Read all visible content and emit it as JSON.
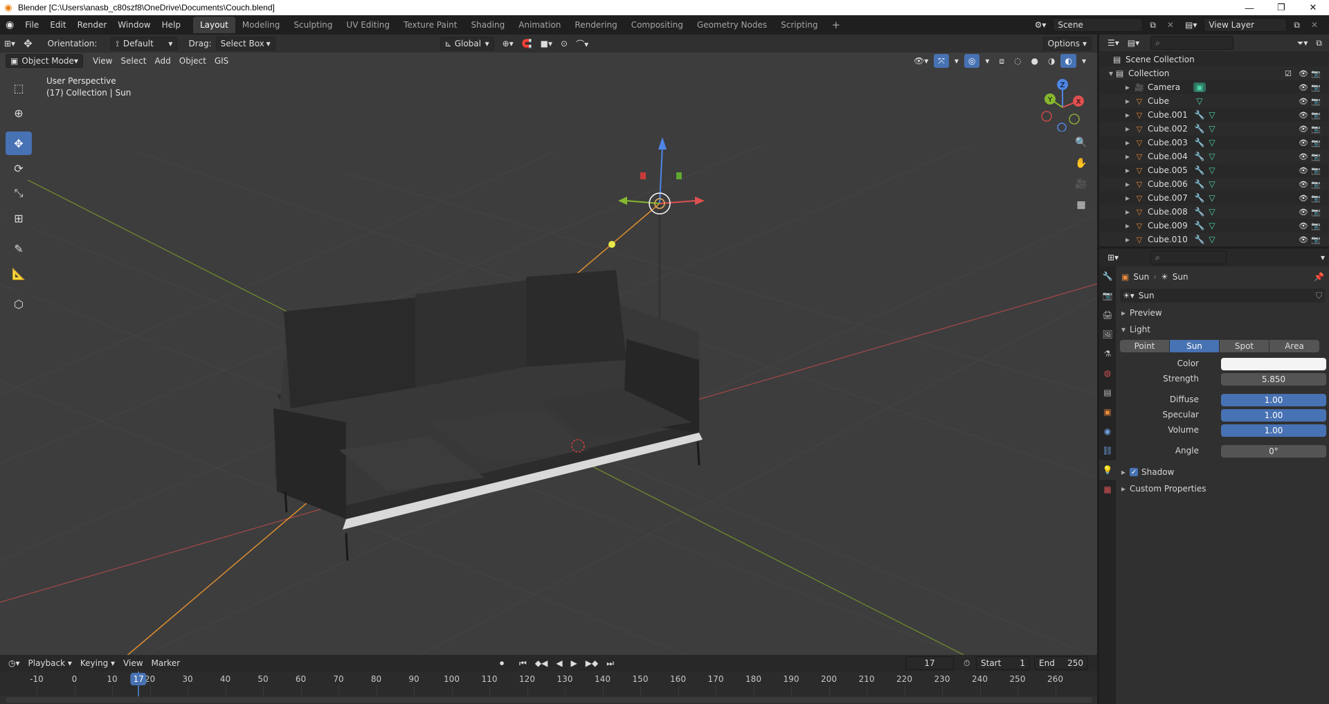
{
  "window": {
    "title": "Blender [C:\\Users\\anasb_c80szf8\\OneDrive\\Documents\\Couch.blend]",
    "controls": [
      "—",
      "❐",
      "✕"
    ]
  },
  "menu": [
    "File",
    "Edit",
    "Render",
    "Window",
    "Help"
  ],
  "workspaces": [
    "Layout",
    "Modeling",
    "Sculpting",
    "UV Editing",
    "Texture Paint",
    "Shading",
    "Animation",
    "Rendering",
    "Compositing",
    "Geometry Nodes",
    "Scripting"
  ],
  "active_workspace": "Layout",
  "scene": {
    "name": "Scene",
    "view_layer": "View Layer"
  },
  "tool_header": {
    "orientation_label": "Orientation:",
    "orientation_value": "Default",
    "drag_label": "Drag:",
    "drag_value": "Select Box",
    "transform_orientation": "Global",
    "options": "Options"
  },
  "viewport_header": {
    "mode": "Object Mode",
    "menus": [
      "View",
      "Select",
      "Add",
      "Object",
      "GIS"
    ]
  },
  "viewport": {
    "perspective": "User Perspective",
    "collection_info": "(17) Collection | Sun",
    "gizmo_axes": {
      "z": "Z",
      "y": "Y",
      "x": "X"
    }
  },
  "timeline": {
    "menus": [
      "Playback",
      "Keying",
      "View",
      "Marker"
    ],
    "current_frame": "17",
    "start_label": "Start",
    "start": "1",
    "end_label": "End",
    "end": "250",
    "ruler": [
      "-10",
      "0",
      "10",
      "20",
      "30",
      "40",
      "50",
      "60",
      "70",
      "80",
      "90",
      "100",
      "110",
      "120",
      "130",
      "140",
      "150",
      "160",
      "170",
      "180",
      "190",
      "200",
      "210",
      "220",
      "230",
      "240",
      "250",
      "260"
    ],
    "playhead": "17"
  },
  "outliner": {
    "scene_collection": "Scene Collection",
    "collection": "Collection",
    "items": [
      {
        "name": "Camera",
        "type": "camera"
      },
      {
        "name": "Cube",
        "type": "mesh"
      },
      {
        "name": "Cube.001",
        "type": "mesh_mod"
      },
      {
        "name": "Cube.002",
        "type": "mesh_mod"
      },
      {
        "name": "Cube.003",
        "type": "mesh_mod"
      },
      {
        "name": "Cube.004",
        "type": "mesh_mod"
      },
      {
        "name": "Cube.005",
        "type": "mesh_mod"
      },
      {
        "name": "Cube.006",
        "type": "mesh_mod"
      },
      {
        "name": "Cube.007",
        "type": "mesh_mod"
      },
      {
        "name": "Cube.008",
        "type": "mesh_mod"
      },
      {
        "name": "Cube.009",
        "type": "mesh_mod"
      },
      {
        "name": "Cube.010",
        "type": "mesh_mod"
      }
    ]
  },
  "properties": {
    "breadcrumb_object": "Sun",
    "breadcrumb_data": "Sun",
    "datablock_name": "Sun",
    "panels": {
      "preview": "Preview",
      "light": "Light",
      "shadow": "Shadow",
      "custom_properties": "Custom Properties"
    },
    "light_types": [
      "Point",
      "Sun",
      "Spot",
      "Area"
    ],
    "active_light_type": "Sun",
    "fields": {
      "color_label": "Color",
      "strength_label": "Strength",
      "strength": "5.850",
      "diffuse_label": "Diffuse",
      "diffuse": "1.00",
      "specular_label": "Specular",
      "specular": "1.00",
      "volume_label": "Volume",
      "volume": "1.00",
      "angle_label": "Angle",
      "angle": "0°"
    },
    "shadow_enabled": true
  },
  "colors": {
    "accent": "#4772b3",
    "viewport_bg": "#3d3d3d",
    "object_orange": "#e8893a",
    "mesh_green": "#4fd6a8"
  }
}
